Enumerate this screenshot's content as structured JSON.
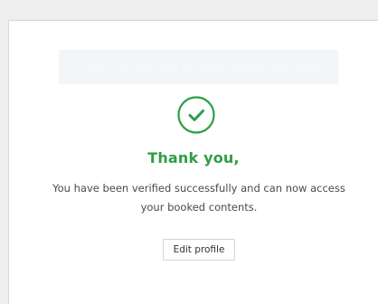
{
  "notice": {
    "text": "Login to access your exclusive content and more"
  },
  "icons": {
    "check": "check-circle-icon"
  },
  "colors": {
    "accent": "#2e9e45",
    "text": "#4a4a4a",
    "page_background": "#eeeeee",
    "card_background": "#ffffff"
  },
  "main": {
    "title": "Thank you,",
    "message": "You have been verified successfully and can now access your booked contents.",
    "edit_profile_label": "Edit profile"
  }
}
